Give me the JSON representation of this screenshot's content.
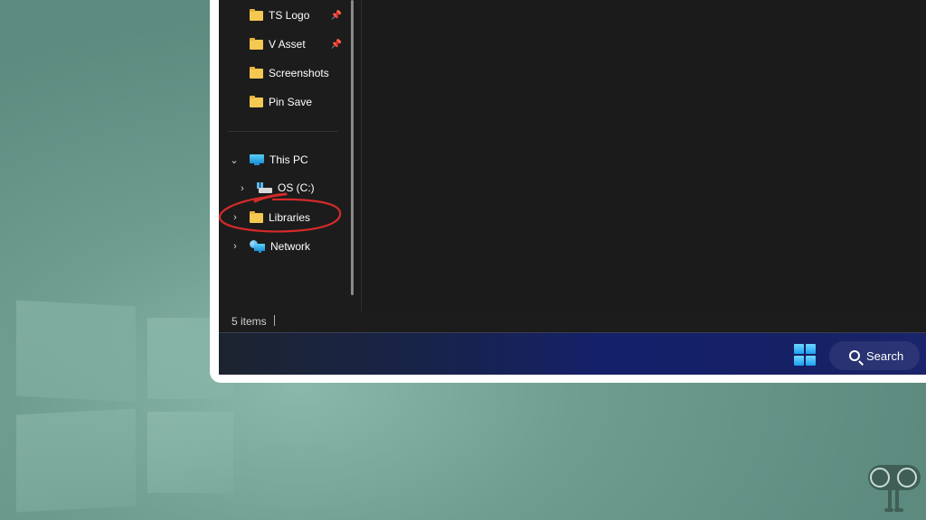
{
  "navigation": {
    "quick_access": [
      {
        "label": "TS Logo",
        "icon": "folder-icon",
        "pinned": true
      },
      {
        "label": "V Asset",
        "icon": "folder-icon",
        "pinned": true
      },
      {
        "label": "Screenshots",
        "icon": "folder-icon",
        "pinned": false
      },
      {
        "label": "Pin Save",
        "icon": "folder-icon",
        "pinned": false
      }
    ],
    "tree": [
      {
        "label": "This PC",
        "icon": "computer-icon",
        "expanded": true
      },
      {
        "label": "OS (C:)",
        "icon": "drive-icon",
        "expanded": false
      },
      {
        "label": "Libraries",
        "icon": "folder-icon",
        "expanded": false,
        "highlighted": true
      },
      {
        "label": "Network",
        "icon": "network-icon",
        "expanded": false
      }
    ]
  },
  "status_bar": {
    "item_count": "5 items"
  },
  "taskbar": {
    "search_label": "Search",
    "accent_color": "#1ba0f0"
  },
  "annotation": {
    "highlight_color": "#d42a2a",
    "target": "Libraries"
  }
}
